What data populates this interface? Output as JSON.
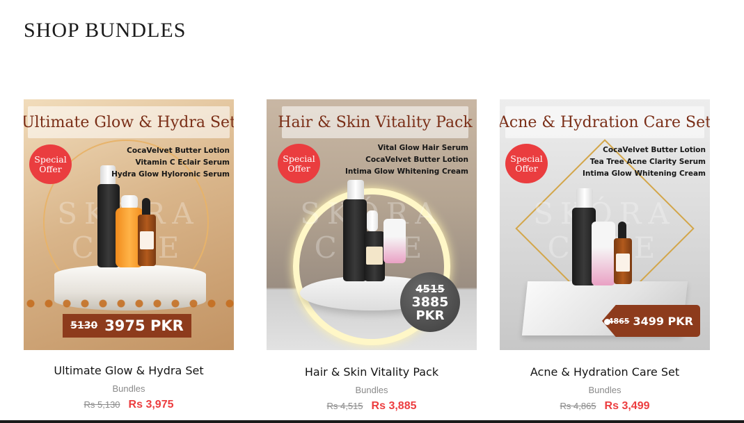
{
  "section": {
    "title": "SHOP BUNDLES"
  },
  "brand": {
    "watermark": "SKÓRA CARE"
  },
  "products": [
    {
      "image_title": "Ultimate Glow & Hydra Set",
      "badge_line1": "Special",
      "badge_line2": "Offer",
      "items": [
        "CocaVelvet Butter Lotion",
        "Vitamin C Eclair Serum",
        "Hydra Glow Hyloronic Serum"
      ],
      "image_old_price": "5130",
      "image_new_price": "3975 PKR",
      "title": "Ultimate Glow & Hydra Set",
      "category": "Bundles",
      "price_old": "Rs 5,130",
      "price_new": "Rs 3,975"
    },
    {
      "image_title": "Hair & Skin Vitality Pack",
      "badge_line1": "Special",
      "badge_line2": "Offer",
      "items": [
        "Vital Glow Hair Serum",
        "CocaVelvet Butter Lotion",
        "Intima Glow Whitening Cream"
      ],
      "image_old_price": "4515",
      "image_new_price": "3885",
      "image_currency": "PKR",
      "title": "Hair & Skin Vitality Pack",
      "category": "Bundles",
      "price_old": "Rs 4,515",
      "price_new": "Rs 3,885"
    },
    {
      "image_title": "Acne & Hydration Care Set",
      "badge_line1": "Special",
      "badge_line2": "Offer",
      "items": [
        "CocaVelvet Butter Lotion",
        "Tea Tree Acne  Clarity Serum",
        "Intima Glow Whitening Cream"
      ],
      "image_old_price": "4865",
      "image_new_price": "3499 PKR",
      "title": "Acne & Hydration Care Set",
      "category": "Bundles",
      "price_old": "Rs 4,865",
      "price_new": "Rs 3,499"
    }
  ],
  "colors": {
    "accent_price": "#ec3d3f",
    "badge": "#ea3d3f",
    "brand_brown": "#8d3b1c",
    "title_brown": "#7a2e17"
  }
}
